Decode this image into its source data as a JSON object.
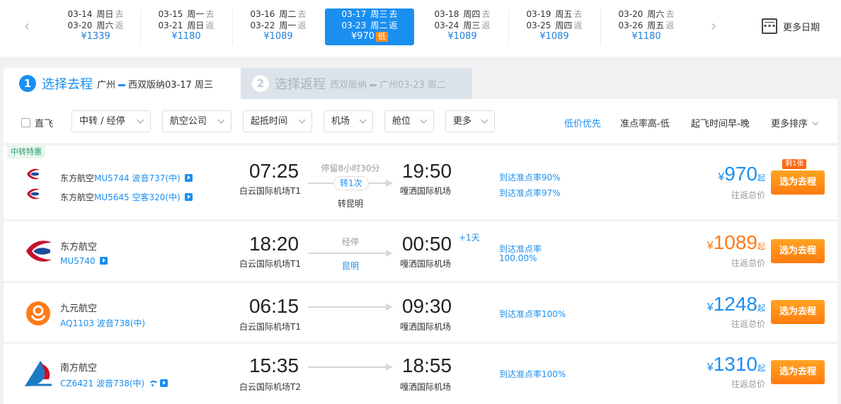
{
  "date_bar": {
    "prev_icon": "chevron-left-icon",
    "next_icon": "chevron-right-icon",
    "more_dates_label": "更多日期",
    "more_dates_icon": "calendar-icon",
    "dates": [
      {
        "go_date": "03-14",
        "go_week": "周日",
        "go_tag": "去",
        "ret_date": "03-20",
        "ret_week": "周六",
        "ret_tag": "返",
        "price": "¥1339"
      },
      {
        "go_date": "03-15",
        "go_week": "周一",
        "go_tag": "去",
        "ret_date": "03-21",
        "ret_week": "周日",
        "ret_tag": "返",
        "price": "¥1180"
      },
      {
        "go_date": "03-16",
        "go_week": "周二",
        "go_tag": "去",
        "ret_date": "03-22",
        "ret_week": "周一",
        "ret_tag": "返",
        "price": "¥1089"
      },
      {
        "go_date": "03-17",
        "go_week": "周三",
        "go_tag": "去",
        "ret_date": "03-23",
        "ret_week": "周二",
        "ret_tag": "返",
        "price": "¥970",
        "low_badge": "低",
        "selected": true
      },
      {
        "go_date": "03-18",
        "go_week": "周四",
        "go_tag": "去",
        "ret_date": "03-24",
        "ret_week": "周三",
        "ret_tag": "返",
        "price": "¥1089"
      },
      {
        "go_date": "03-19",
        "go_week": "周五",
        "go_tag": "去",
        "ret_date": "03-25",
        "ret_week": "周四",
        "ret_tag": "返",
        "price": "¥1089"
      },
      {
        "go_date": "03-20",
        "go_week": "周六",
        "go_tag": "去",
        "ret_date": "03-26",
        "ret_week": "周五",
        "ret_tag": "返",
        "price": "¥1180"
      }
    ]
  },
  "tabs": {
    "outbound": {
      "number": "1",
      "title": "选择去程",
      "from": "广州",
      "to": "西双版纳",
      "date": "03-17 周三"
    },
    "return": {
      "number": "2",
      "title": "选择返程",
      "from": "西双版纳",
      "to": "广州",
      "date": "03-23 周二"
    }
  },
  "filters": {
    "direct_label": "直飞",
    "dropdowns": [
      "中转 / 经停",
      "航空公司",
      "起抵时间",
      "机场",
      "舱位",
      "更多"
    ],
    "sorts": [
      "低价优先",
      "准点率高-低",
      "起飞时间早-晚",
      "更多排序"
    ]
  },
  "flights": [
    {
      "tag": "中转特惠",
      "legs": [
        {
          "airline": "东方航空",
          "flight_no": "MU5744",
          "aircraft": "波音737(中)"
        },
        {
          "airline": "东方航空",
          "flight_no": "MU5645",
          "aircraft": "空客320(中)"
        }
      ],
      "dep_time": "07:25",
      "dep_airport": "白云国际机场T1",
      "arr_time": "19:50",
      "arr_airport": "嘎洒国际机场",
      "stop_top": "停留8小时30分",
      "stop_mid": "转1次",
      "stop_bottom": "转昆明",
      "ontime": [
        "到达准点率90%",
        "到达准点率97%"
      ],
      "currency": "¥",
      "price": "970",
      "price_suffix": "起",
      "price_label": "往返总价",
      "seats_left": "剩1张",
      "button": "选为去程"
    },
    {
      "airline": "东方航空",
      "flight_no": "MU5740",
      "dep_time": "18:20",
      "dep_airport": "白云国际机场T1",
      "arr_time": "00:50",
      "arr_airport": "嘎洒国际机场",
      "plus_day": "+1天",
      "stop_top": "经停",
      "stop_bottom": "昆明",
      "ontime": [
        "到达准点率",
        "100.00%"
      ],
      "currency": "¥",
      "price": "1089",
      "price_suffix": "起",
      "price_label": "往返总价",
      "button": "选为去程"
    },
    {
      "airline": "九元航空",
      "flight_no": "AQ1103",
      "aircraft": "波音738(中)",
      "dep_time": "06:15",
      "dep_airport": "白云国际机场T1",
      "arr_time": "09:30",
      "arr_airport": "嘎洒国际机场",
      "ontime": [
        "到达准点率100%"
      ],
      "currency": "¥",
      "price": "1248",
      "price_suffix": "起",
      "price_label": "往返总价",
      "button": "选为去程"
    },
    {
      "airline": "南方航空",
      "flight_no": "CZ6421",
      "aircraft": "波音738(中)",
      "dep_time": "15:35",
      "dep_airport": "白云国际机场T2",
      "arr_time": "18:55",
      "arr_airport": "嘎洒国际机场",
      "ontime": [
        "到达准点率100%"
      ],
      "currency": "¥",
      "price": "1310",
      "price_suffix": "起",
      "price_label": "往返总价",
      "button": "选为去程"
    }
  ],
  "colors": {
    "accent": "#1b8ff0",
    "orange": "#ff7a1a",
    "button": "#ff8a1a"
  }
}
